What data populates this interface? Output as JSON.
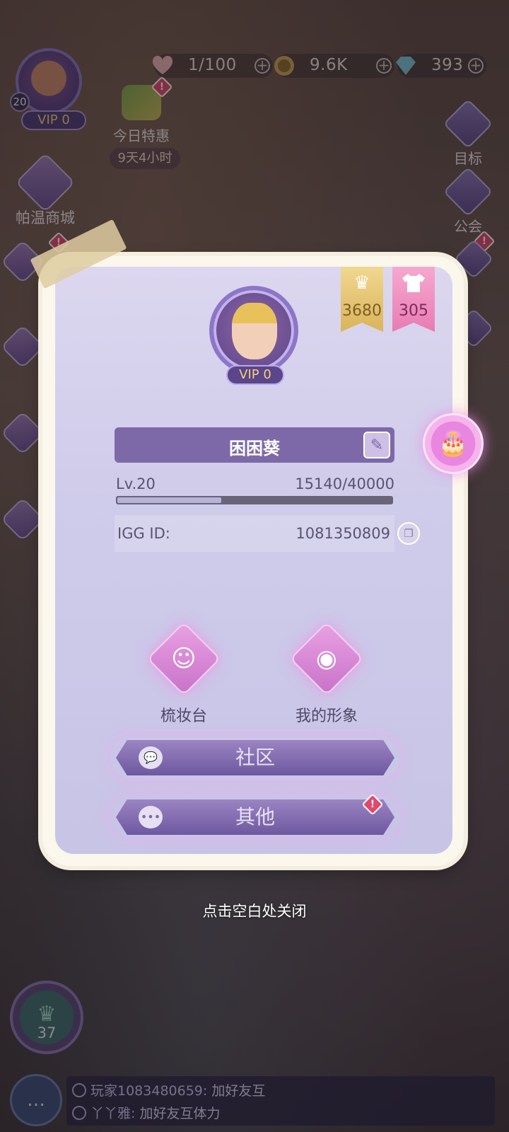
{
  "resources": {
    "stamina": "1/100",
    "coins": "9.6K",
    "diamonds": "393"
  },
  "player_top": {
    "level": "20",
    "vip": "VIP 0"
  },
  "left_menu": {
    "promo_label": "今日特惠",
    "promo_timer": "9天4小时",
    "shop_label": "帕温商城"
  },
  "right_menu": {
    "goals_label": "目标",
    "guild_label": "公会"
  },
  "profile": {
    "crown_score": "3680",
    "outfit_score": "305",
    "vip": "VIP 0",
    "name": "困困葵",
    "level_label": "Lv.20",
    "xp": "15140/40000",
    "xp_fraction": 0.3785,
    "id_label": "IGG ID:",
    "id_value": "1081350809",
    "dresser_label": "梳妆台",
    "my_look_label": "我的形象",
    "community_label": "社区",
    "other_label": "其他"
  },
  "close_hint": "点击空白处关闭",
  "bottom": {
    "crown_level": "37"
  },
  "chat": {
    "line1_name": "玩家1083480659:",
    "line1_text": " 加好友互",
    "line2_name": "丫丫雅:",
    "line2_text": " 加好友互体力"
  }
}
